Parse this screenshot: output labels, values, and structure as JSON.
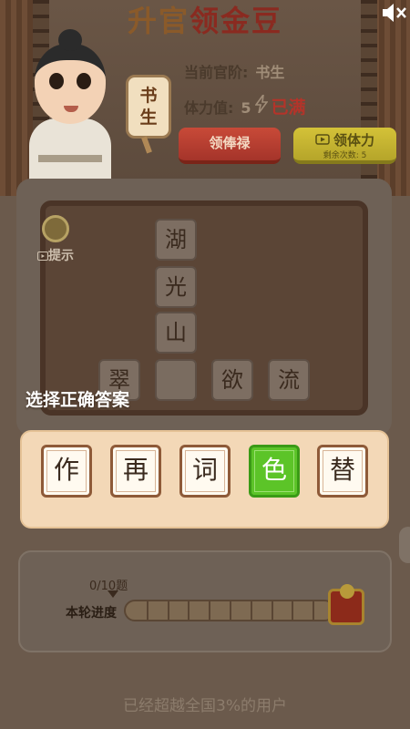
{
  "header": {
    "title_part1": "升官",
    "title_part2": "领金豆",
    "sound_icon": "speaker-mute-icon"
  },
  "player": {
    "badge": [
      "书",
      "生"
    ],
    "rank_label": "当前官阶:",
    "rank_value": "书生",
    "energy_label": "体力值:",
    "energy_value": "5",
    "energy_status": "已满"
  },
  "buttons": {
    "salary": "领俸禄",
    "energy": "领体力",
    "energy_remaining": "剩余次数: 5"
  },
  "hint": {
    "label": "提示"
  },
  "puzzle": {
    "vertical": [
      "湖",
      "光",
      "山"
    ],
    "horizontal": [
      "翠",
      "",
      "欲",
      "流"
    ],
    "prompt": "选择正确答案"
  },
  "options": [
    {
      "char": "作",
      "selected": false
    },
    {
      "char": "再",
      "selected": false
    },
    {
      "char": "词",
      "selected": false
    },
    {
      "char": "色",
      "selected": true
    },
    {
      "char": "替",
      "selected": false
    }
  ],
  "progress": {
    "count": "0/10题",
    "label": "本轮进度",
    "fraction": 0
  },
  "footer": "已经超越全国3%的用户",
  "colors": {
    "accent_red": "#b3342a",
    "selected_green": "#5cc428",
    "button_yellow": "#d4c238"
  }
}
